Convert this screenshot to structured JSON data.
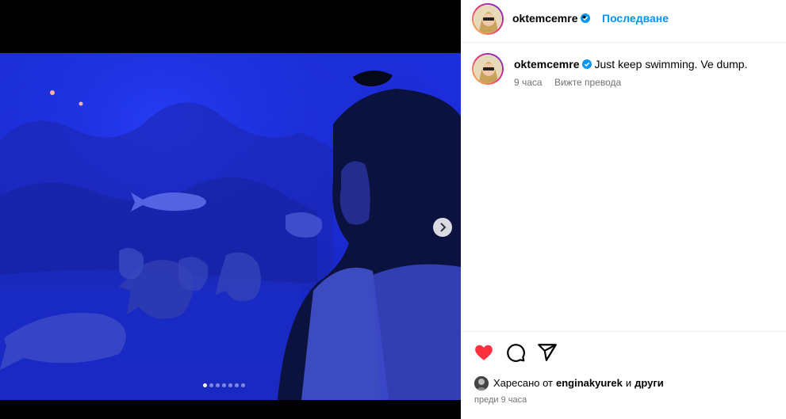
{
  "header": {
    "username": "oktemcemre",
    "separator": "•",
    "follow_label": "Последване"
  },
  "caption": {
    "username": "oktemcemre",
    "text": "Just keep swimming. Ve dump.",
    "time": "9 часа",
    "translate_label": "Вижте превода"
  },
  "carousel": {
    "slide_count": 7,
    "active_index": 1
  },
  "likes": {
    "prefix": "Харесано от",
    "user": "enginakyurek",
    "conjunction": "и",
    "others": "други"
  },
  "post_time": "преди 9 часа",
  "icons": {
    "like": "heart-filled-icon",
    "comment": "comment-icon",
    "share": "share-icon",
    "next": "chevron-right-icon",
    "verified": "verified-badge-icon"
  },
  "colors": {
    "like": "#ff3040",
    "follow": "#0095f6",
    "verified": "#0095f6",
    "aquarium": "#1a2bd6"
  }
}
